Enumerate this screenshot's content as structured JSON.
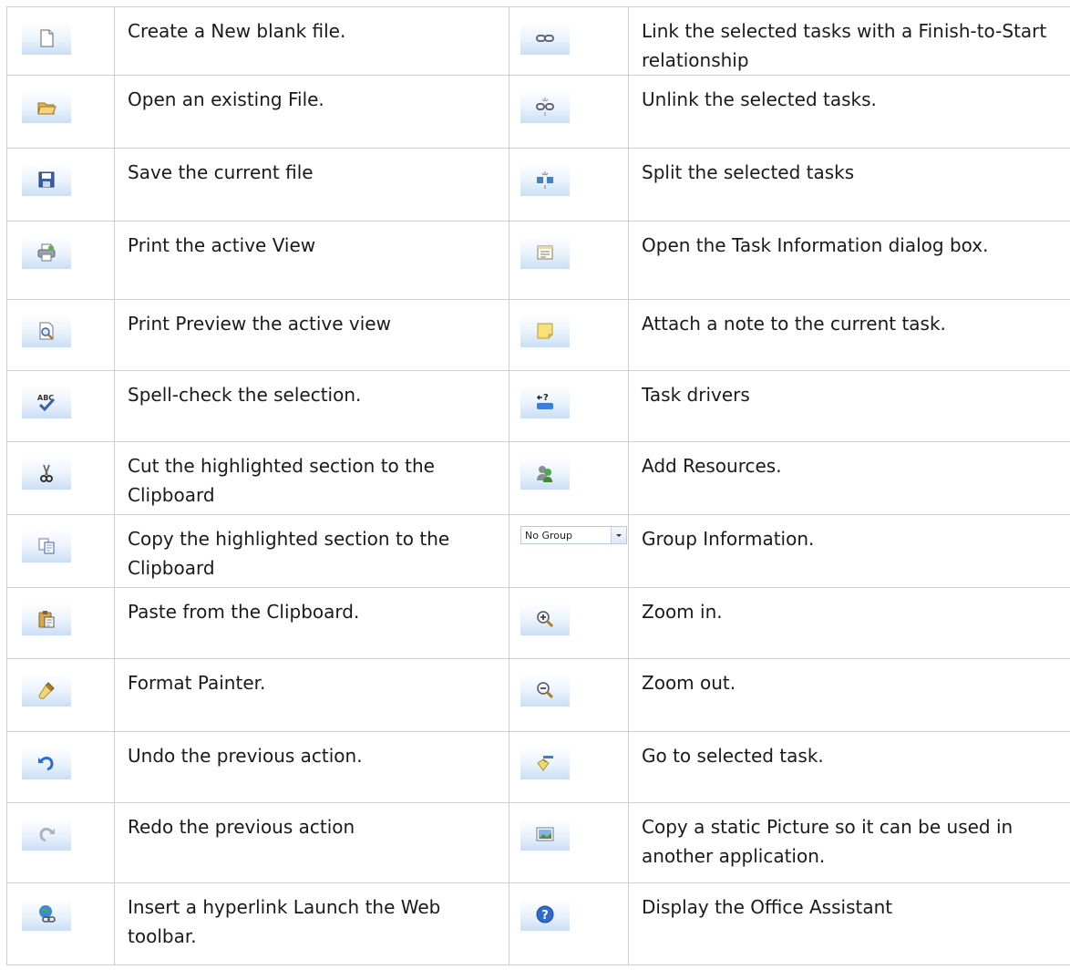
{
  "rows": [
    {
      "left": {
        "icon": "new-file-icon",
        "text": "Create a New blank file."
      },
      "right": {
        "icon": "link-tasks-icon",
        "text": "Link the selected tasks with a Finish-to-Start relationship"
      }
    },
    {
      "left": {
        "icon": "open-folder-icon",
        "text": "Open an existing File."
      },
      "right": {
        "icon": "unlink-tasks-icon",
        "text": "Unlink the selected tasks."
      }
    },
    {
      "left": {
        "icon": "save-icon",
        "text": "Save the current file"
      },
      "right": {
        "icon": "split-task-icon",
        "text": "Split the selected tasks"
      }
    },
    {
      "left": {
        "icon": "print-icon",
        "text": "Print the active View"
      },
      "right": {
        "icon": "task-information-icon",
        "text": "Open the Task Information dialog box."
      }
    },
    {
      "left": {
        "icon": "print-preview-icon",
        "text": "Print Preview the active view"
      },
      "right": {
        "icon": "task-note-icon",
        "text": "Attach a note to the current task."
      }
    },
    {
      "left": {
        "icon": "spell-check-icon",
        "text": "Spell-check the selection."
      },
      "right": {
        "icon": "task-drivers-icon",
        "text": "Task drivers"
      }
    },
    {
      "left": {
        "icon": "cut-icon",
        "text": "Cut the highlighted section to the Clipboard"
      },
      "right": {
        "icon": "add-resources-icon",
        "text": "Add Resources."
      }
    },
    {
      "left": {
        "icon": "copy-icon",
        "text": "Copy the highlighted section to the Clipboard"
      },
      "right": {
        "icon": "group-dropdown",
        "text": "Group Information.",
        "dropdown_value": "No Group"
      }
    },
    {
      "left": {
        "icon": "paste-icon",
        "text": "Paste from the Clipboard."
      },
      "right": {
        "icon": "zoom-in-icon",
        "text": "Zoom in."
      }
    },
    {
      "left": {
        "icon": "format-painter-icon",
        "text": "Format Painter."
      },
      "right": {
        "icon": "zoom-out-icon",
        "text": "Zoom out."
      }
    },
    {
      "left": {
        "icon": "undo-icon",
        "text": "Undo the previous action."
      },
      "right": {
        "icon": "go-to-task-icon",
        "text": "Go to selected task."
      }
    },
    {
      "left": {
        "icon": "redo-icon",
        "text": "Redo the previous action"
      },
      "right": {
        "icon": "copy-picture-icon",
        "text": "Copy a static Picture so it can be used in another application."
      }
    },
    {
      "left": {
        "icon": "hyperlink-icon",
        "text": "Insert a hyperlink Launch the Web toolbar."
      },
      "right": {
        "icon": "help-icon",
        "text": "Display the Office Assistant"
      }
    }
  ]
}
